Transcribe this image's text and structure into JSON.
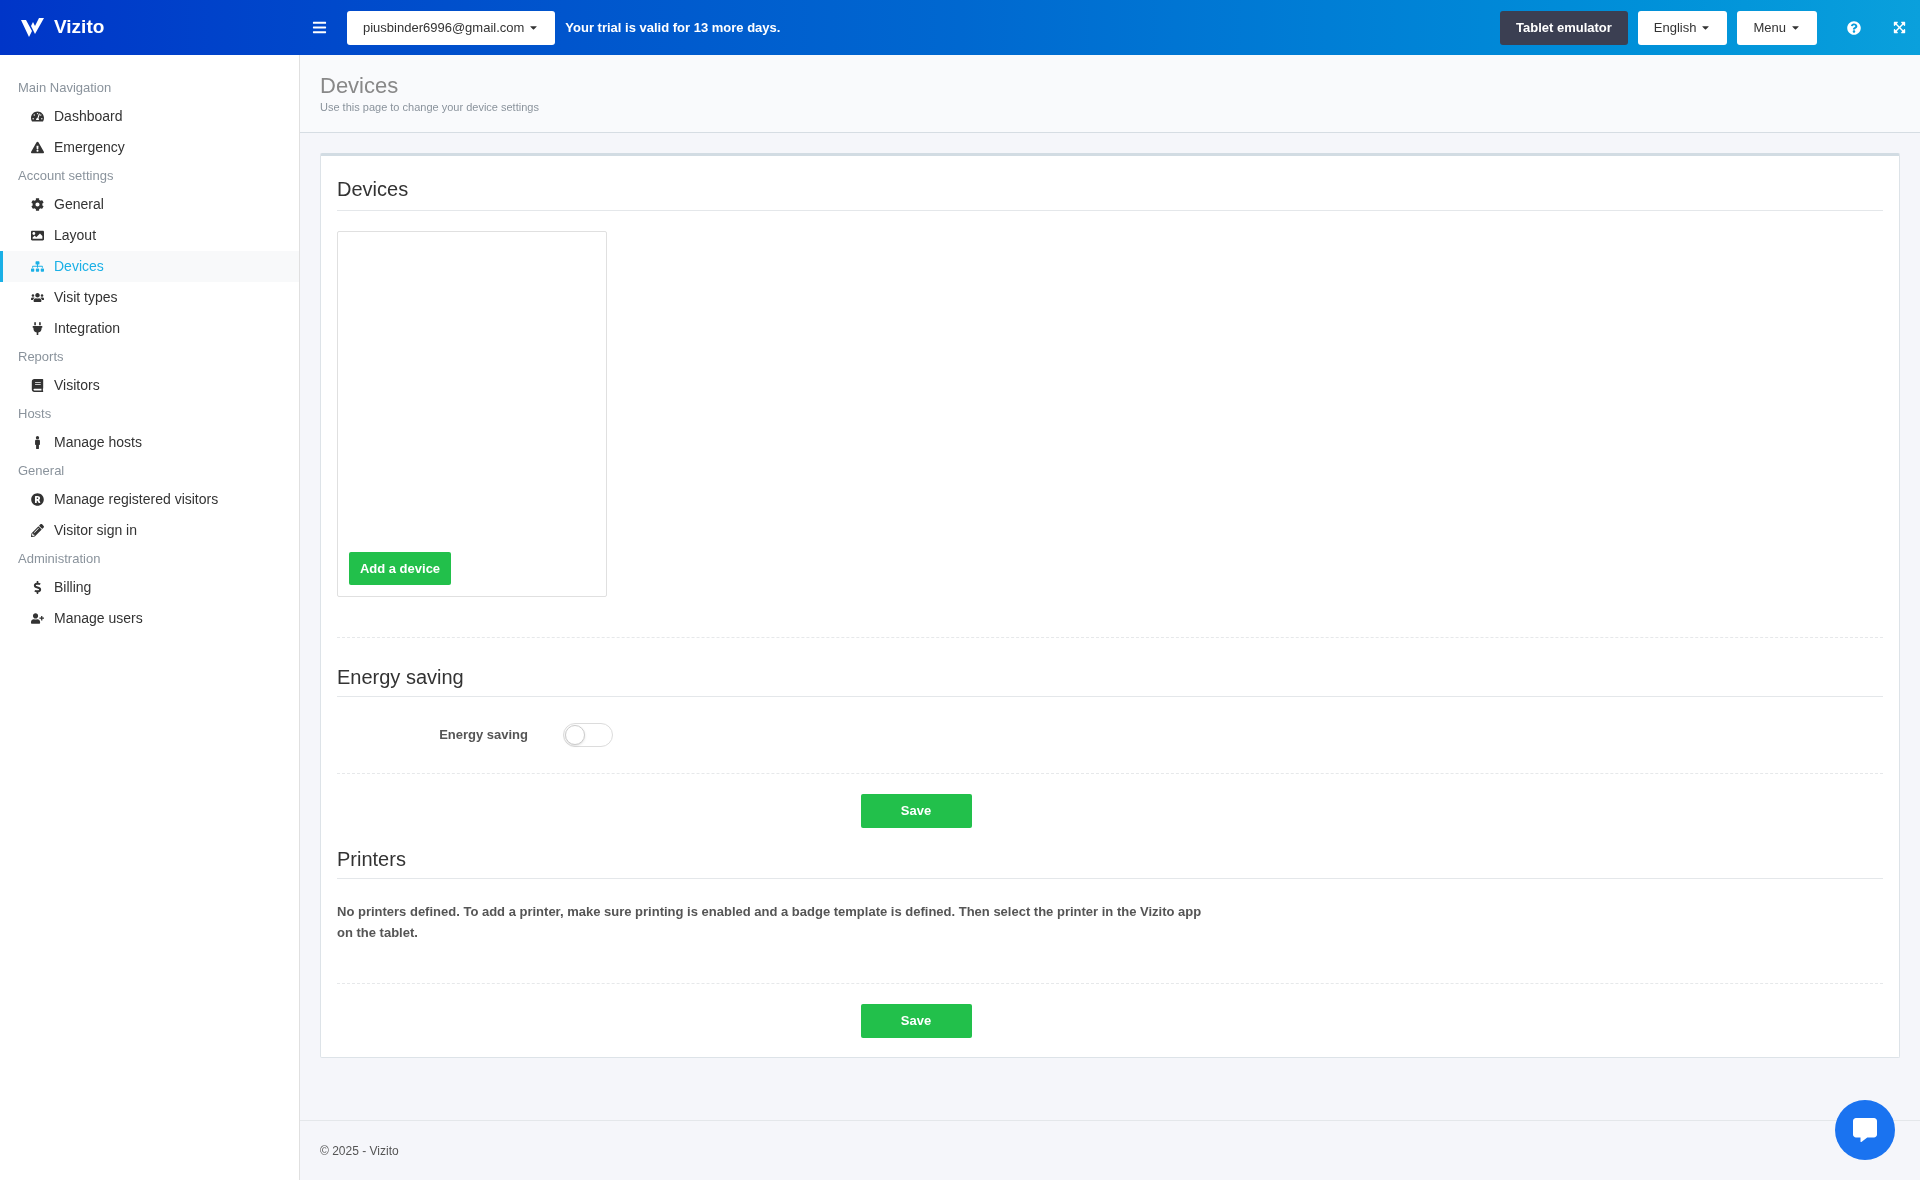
{
  "header": {
    "brand": "Vizito",
    "account": "piusbinder6996@gmail.com",
    "trial_notice": "Your trial is valid for 13 more days.",
    "buttons": [
      {
        "label": "Tablet emulator",
        "kind": "dark",
        "dropdown": false
      },
      {
        "label": "English",
        "kind": "light",
        "dropdown": true
      },
      {
        "label": "Menu",
        "kind": "light",
        "dropdown": true
      }
    ]
  },
  "sidebar": {
    "groups": [
      {
        "heading": "Main Navigation",
        "items": [
          {
            "label": "Dashboard",
            "selected": false
          },
          {
            "label": "Emergency",
            "selected": false
          }
        ]
      },
      {
        "heading": "Account settings",
        "items": [
          {
            "label": "General",
            "selected": false
          },
          {
            "label": "Layout",
            "selected": false
          },
          {
            "label": "Devices",
            "selected": true
          },
          {
            "label": "Visit types",
            "selected": false
          },
          {
            "label": "Integration",
            "selected": false
          }
        ]
      },
      {
        "heading": "Reports",
        "items": [
          {
            "label": "Visitors",
            "selected": false
          }
        ]
      },
      {
        "heading": "Hosts",
        "items": [
          {
            "label": "Manage hosts",
            "selected": false
          }
        ]
      },
      {
        "heading": "General",
        "items": [
          {
            "label": "Manage registered visitors",
            "selected": false
          },
          {
            "label": "Visitor sign in",
            "selected": false
          }
        ]
      },
      {
        "heading": "Administration",
        "items": [
          {
            "label": "Billing",
            "selected": false
          },
          {
            "label": "Manage users",
            "selected": false
          }
        ]
      }
    ]
  },
  "page": {
    "title": "Devices",
    "subtitle": "Use this page to change your device settings"
  },
  "devices": {
    "heading": "Devices",
    "add_button": "Add a device"
  },
  "energy": {
    "heading": "Energy saving",
    "label": "Energy saving",
    "on": false,
    "save": "Save"
  },
  "printers": {
    "heading": "Printers",
    "message": "No printers defined. To add a printer, make sure printing is enabled and a badge template is defined. Then select the printer in the Vizito app on the tablet.",
    "save": "Save"
  },
  "footer": {
    "copyright": "© 2025 - Vizito"
  }
}
